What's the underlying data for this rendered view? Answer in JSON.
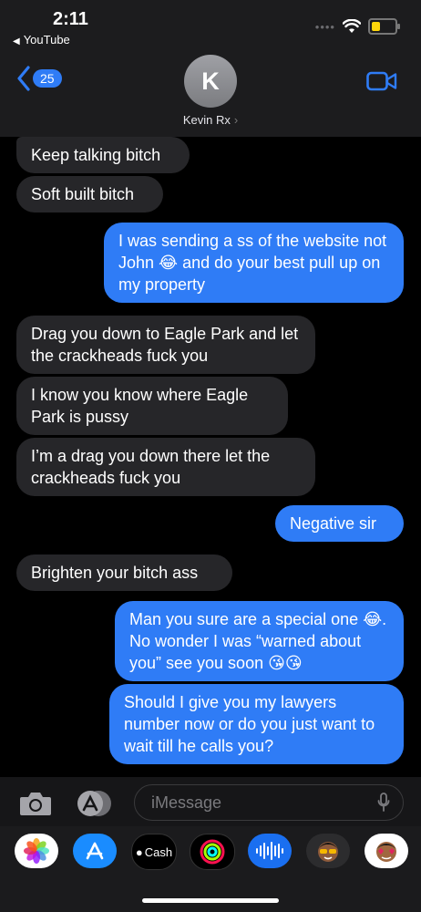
{
  "status": {
    "time": "2:11",
    "back_app": "YouTube"
  },
  "header": {
    "unread_count": "25",
    "avatar_letter": "K",
    "contact_name": "Kevin Rx"
  },
  "messages": [
    {
      "dir": "in",
      "text": "Keep talking bitch"
    },
    {
      "dir": "in",
      "text": "Soft built bitch"
    },
    {
      "dir": "out",
      "text": "I was sending a ss of the website not John 😂 and do your best pull up on my property"
    },
    {
      "dir": "in",
      "text": "Drag you down to Eagle Park and let the crackheads fuck you"
    },
    {
      "dir": "in",
      "text": "I know you know where Eagle Park is pussy"
    },
    {
      "dir": "in",
      "text": "I’m a drag you down there let the crackheads fuck you"
    },
    {
      "dir": "out",
      "text": "Negative sir"
    },
    {
      "dir": "in",
      "text": "Brighten your bitch ass"
    },
    {
      "dir": "out",
      "text": "Man you sure are a special one 😂. No wonder I was “warned about you”  see you soon 😘😘"
    },
    {
      "dir": "out",
      "text": "Should I give you my lawyers number now or do you just want to wait till he calls you?"
    }
  ],
  "input": {
    "placeholder": "iMessage"
  },
  "apps": {
    "photos": "photos-icon",
    "appstore": "app-store-icon",
    "cash_label": "Cash",
    "fitness": "activity-icon",
    "audio": "audio-message-icon",
    "memoji1": "memoji-icon",
    "memoji2": "memoji-stickers-icon"
  },
  "colors": {
    "accent": "#2f7cf6",
    "incoming_bubble": "#262629",
    "battery": "#ffd60a"
  }
}
